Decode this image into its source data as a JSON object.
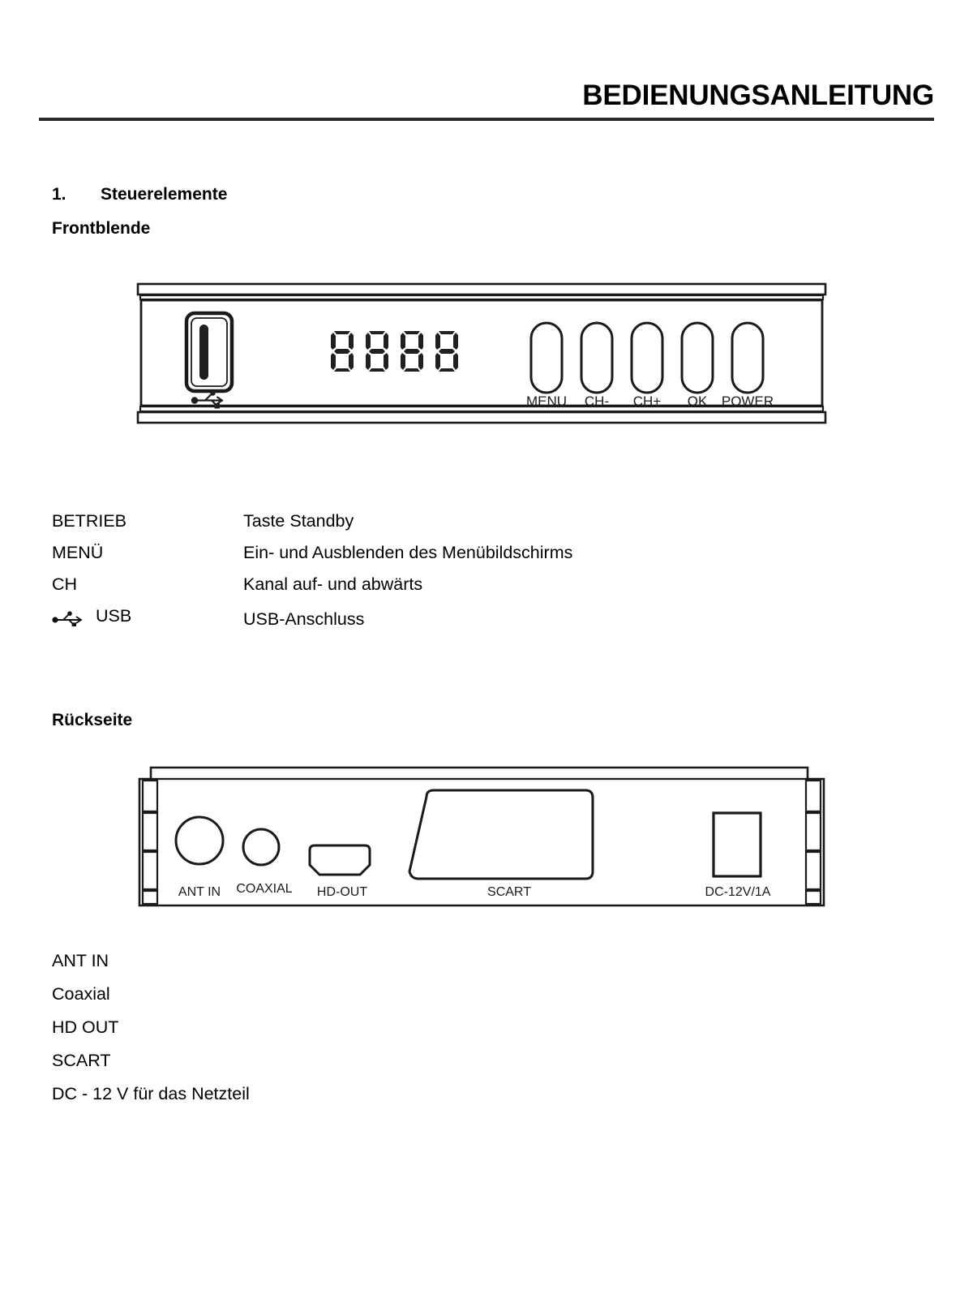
{
  "document": {
    "header_title": "BEDIENUNGSANLEITUNG"
  },
  "sections": {
    "controls": {
      "number": "1.",
      "title": "Steuerelemente",
      "front_heading": "Frontblende",
      "rear_heading": "Rückseite"
    }
  },
  "front_panel": {
    "display_digits": "8888",
    "usb_port_label": "USB",
    "buttons": [
      {
        "label": "MENU"
      },
      {
        "label": "CH-"
      },
      {
        "label": "CH+"
      },
      {
        "label": "OK"
      },
      {
        "label": "POWER"
      }
    ]
  },
  "front_descriptions": [
    {
      "term": "BETRIEB",
      "definition": "Taste Standby",
      "icon": ""
    },
    {
      "term": "MENÜ",
      "definition": "Ein- und Ausblenden des Menübildschirms",
      "icon": ""
    },
    {
      "term": "CH",
      "definition": "Kanal auf- und abwärts",
      "icon": ""
    },
    {
      "term": "USB",
      "definition": "USB-Anschluss",
      "icon": "usb-icon"
    }
  ],
  "rear_panel": {
    "connectors": [
      {
        "label": "ANT IN",
        "type": "circle-large"
      },
      {
        "label": "COAXIAL",
        "type": "circle-small"
      },
      {
        "label": "HD-OUT",
        "type": "hdmi"
      },
      {
        "label": "SCART",
        "type": "scart"
      },
      {
        "label": "DC-12V/1A",
        "type": "dc-jack"
      }
    ]
  },
  "rear_descriptions": [
    {
      "text": "ANT IN"
    },
    {
      "text": "Coaxial"
    },
    {
      "text": "HD OUT"
    },
    {
      "text": "SCART"
    },
    {
      "text": "DC - 12 V für das Netzteil"
    }
  ],
  "colors": {
    "ink": "#1a1a1a",
    "rule": "#2b2b2b",
    "segment": "#231f20",
    "page_background": "#ffffff"
  }
}
